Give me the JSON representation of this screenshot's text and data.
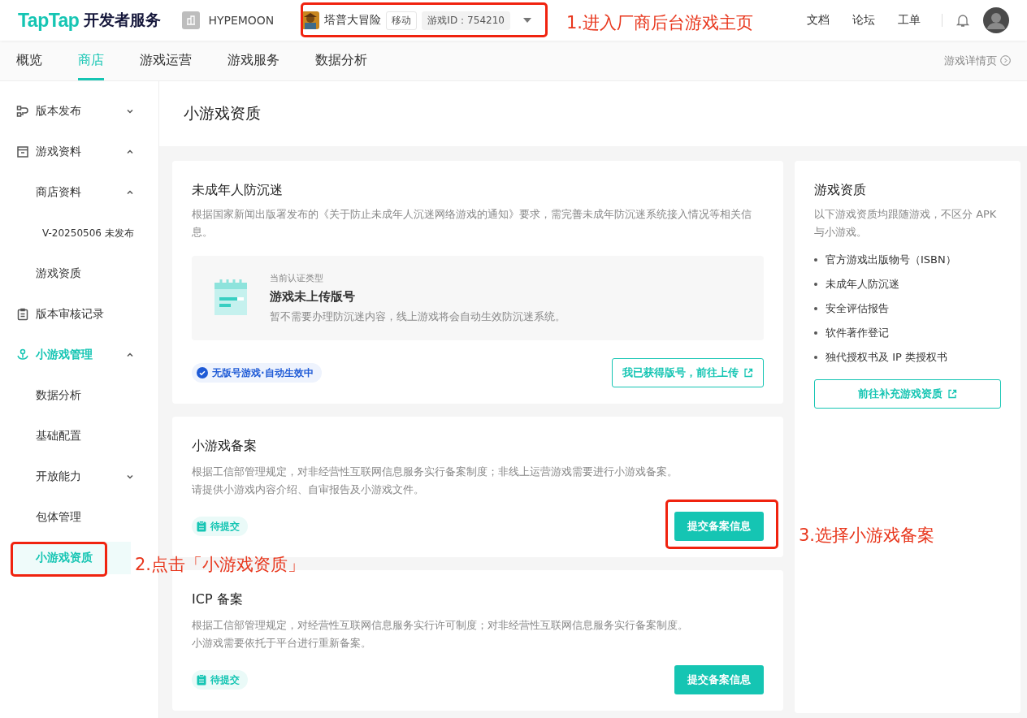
{
  "header": {
    "logo": {
      "brand": "TapTap",
      "product": "开发者服务"
    },
    "org": "HYPEMOON",
    "game": {
      "name": "塔普大冒险",
      "platform": "移动",
      "id": "游戏ID：754210"
    },
    "links": [
      "文档",
      "论坛",
      "工单"
    ]
  },
  "nav": {
    "tabs": [
      {
        "label": "概览",
        "selected": false
      },
      {
        "label": "商店",
        "selected": true
      },
      {
        "label": "游戏运营",
        "selected": false
      },
      {
        "label": "游戏服务",
        "selected": false
      },
      {
        "label": "数据分析",
        "selected": false
      }
    ],
    "detail_link": "游戏详情页"
  },
  "sidebar": {
    "items": [
      {
        "label": "版本发布",
        "expanded": false,
        "selected": false
      },
      {
        "label": "游戏资料",
        "expanded": true,
        "selected": false,
        "children": [
          {
            "label": "商店资料",
            "expanded": true,
            "selected": false,
            "children": [
              {
                "label": "V-20250506 未发布",
                "selected": false
              }
            ]
          },
          {
            "label": "游戏资质",
            "selected": false
          }
        ]
      },
      {
        "label": "版本审核记录",
        "selected": false
      },
      {
        "label": "小游戏管理",
        "expanded": true,
        "selected": true,
        "children": [
          {
            "label": "数据分析",
            "selected": false
          },
          {
            "label": "基础配置",
            "selected": false
          },
          {
            "label": "开放能力",
            "expanded": false,
            "selected": false
          },
          {
            "label": "包体管理",
            "selected": false
          },
          {
            "label": "小游戏资质",
            "selected": true
          }
        ]
      }
    ]
  },
  "page_title": "小游戏资质",
  "minor_card": {
    "title": "未成年人防沉迷",
    "description": "根据国家新闻出版署发布的《关于防止未成年人沉迷网络游戏的通知》要求，需完善未成年防沉迷系统接入情况等相关信息。",
    "cert": {
      "label": "当前认证类型",
      "title": "游戏未上传版号",
      "description": "暂不需要办理防沉迷内容，线上游戏将会自动生效防沉迷系统。"
    },
    "status": {
      "kind": "verified",
      "label": "无版号游戏·自动生效中"
    },
    "button": {
      "kind": "outline",
      "label": "我已获得版号，前往上传"
    }
  },
  "filing_cards": [
    {
      "title": "小游戏备案",
      "description": [
        "根据工信部管理规定，对非经营性互联网信息服务实行备案制度；非线上运营游戏需要进行小游戏备案。",
        "请提供小游戏内容介绍、自审报告及小游戏文件。"
      ],
      "status": {
        "kind": "pending",
        "label": "待提交"
      },
      "button": {
        "kind": "primary",
        "label": "提交备案信息"
      }
    },
    {
      "title": "ICP 备案",
      "description": [
        "根据工信部管理规定，对经营性互联网信息服务实行许可制度；对非经营性互联网信息服务实行备案制度。",
        "小游戏需要依托于平台进行重新备案。"
      ],
      "status": {
        "kind": "pending",
        "label": "待提交"
      },
      "button": {
        "kind": "primary",
        "label": "提交备案信息"
      }
    }
  ],
  "qualification_card": {
    "title": "游戏资质",
    "description": "以下游戏资质均跟随游戏，不区分 APK 与小游戏。",
    "items": [
      "官方游戏出版物号（ISBN）",
      "未成年人防沉迷",
      "安全评估报告",
      "软件著作登记",
      "独代授权书及 IP 类授权书"
    ],
    "button": {
      "kind": "outline",
      "label": "前往补充游戏资质"
    }
  },
  "annotations": [
    {
      "text": "1.进入厂商后台游戏主页"
    },
    {
      "text": "2.点击「小游戏资质」"
    },
    {
      "text": "3.选择小游戏备案"
    }
  ]
}
